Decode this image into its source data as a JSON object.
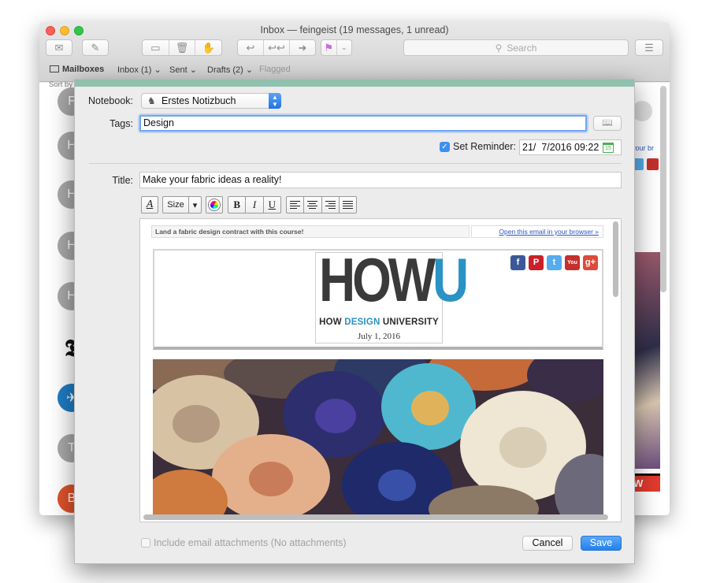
{
  "mail": {
    "window_title": "Inbox — feingeist (19 messages, 1 unread)",
    "search_placeholder": "Search",
    "favorites": {
      "mailboxes": "Mailboxes",
      "inbox": "Inbox (1)",
      "sent": "Sent",
      "drafts": "Drafts (2)",
      "flagged": "Flagged"
    },
    "sort_label": "Sort by",
    "avatar_initials": [
      "F",
      "H",
      "H",
      "H",
      "H",
      "T"
    ],
    "right_snippet": "your br",
    "right_banner_text": "W"
  },
  "sheet": {
    "notebook_label": "Notebook:",
    "notebook_value": "Erstes Notizbuch",
    "tags_label": "Tags:",
    "tags_value": "Design",
    "reminder_label": "Set Reminder:",
    "reminder_value": "21/  7/2016 09:22",
    "reminder_checked": true,
    "title_label": "Title:",
    "title_value": "Make your fabric ideas a reality!",
    "toolbar": {
      "font_glyph": "A",
      "size_label": "Size",
      "bold": "B",
      "italic": "I",
      "underline": "U"
    },
    "include_label": "Include email attachments (No attachments)",
    "cancel_label": "Cancel",
    "save_label": "Save"
  },
  "email": {
    "preheader": "Land a fabric design contract with this course!",
    "browser_link": "Open this email in your browser »",
    "logo_main": "HOW",
    "logo_u": "U",
    "logo_sub_a": "HOW ",
    "logo_sub_b": "DESIGN",
    "logo_sub_c": " UNIVERSITY",
    "date": "July 1, 2016",
    "social": [
      {
        "name": "facebook",
        "glyph": "f",
        "color": "#3b5998"
      },
      {
        "name": "pinterest",
        "glyph": "P",
        "color": "#cb2027"
      },
      {
        "name": "twitter",
        "glyph": "t",
        "color": "#55acee"
      },
      {
        "name": "youtube",
        "glyph": "You",
        "color": "#c4302b"
      },
      {
        "name": "google-plus",
        "glyph": "g+",
        "color": "#dd4b39"
      }
    ]
  },
  "colors": {
    "accent": "#3f8ef2",
    "sheet_top": "#8fc1ae",
    "brand_blue": "#2a92c5"
  }
}
